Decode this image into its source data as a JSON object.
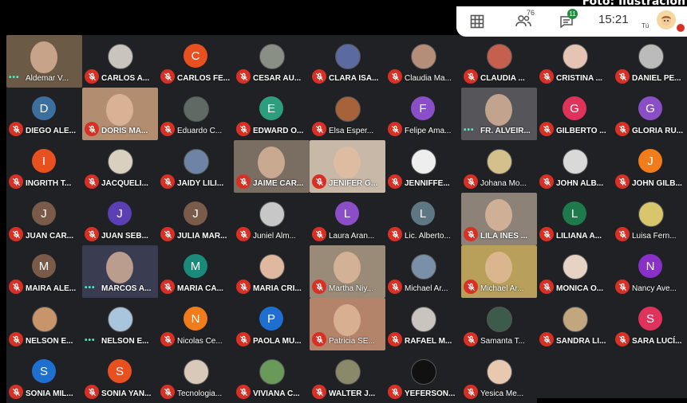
{
  "photo_credit": "Foto: Ilustración",
  "toolbar": {
    "people_count": "76",
    "chat_count": "11",
    "time": "15:21",
    "self_label": "Tú",
    "icons": [
      "grid-icon",
      "people-icon",
      "chat-icon",
      "avatar"
    ]
  },
  "colors": {
    "grid_bg": "#202124",
    "muted_red": "#d93025",
    "speaking_green": "#4ff0c7"
  },
  "participants": [
    {
      "name": "Aldemar V...",
      "kind": "video",
      "mic": "speaking",
      "bg": "#6b5a45"
    },
    {
      "name": "CARLOS A...",
      "kind": "photo",
      "mic": "muted",
      "bg": "#c9c5be"
    },
    {
      "name": "CARLOS FE...",
      "kind": "letter",
      "letter": "C",
      "mic": "muted",
      "bg": "#e8511f"
    },
    {
      "name": "CESAR AU...",
      "kind": "photo",
      "mic": "muted",
      "bg": "#8a8f86"
    },
    {
      "name": "CLARA ISA...",
      "kind": "photo",
      "mic": "muted",
      "bg": "#5b6aa0"
    },
    {
      "name": "Claudia Ma...",
      "kind": "photo",
      "mic": "muted",
      "bg": "#b58e7a"
    },
    {
      "name": "CLAUDIA ...",
      "kind": "photo",
      "mic": "muted",
      "bg": "#c55f4e"
    },
    {
      "name": "CRISTINA ...",
      "kind": "photo",
      "mic": "muted",
      "bg": "#e6c4b3"
    },
    {
      "name": "DANIEL PE...",
      "kind": "photo",
      "mic": "muted",
      "bg": "#bbbbbb"
    },
    {
      "name": "DIEGO ALE...",
      "kind": "letter",
      "letter": "D",
      "mic": "muted",
      "bg": "#3c6e9e"
    },
    {
      "name": "DORIS MA...",
      "kind": "video",
      "mic": "muted",
      "bg": "#b38d70"
    },
    {
      "name": "Eduardo C...",
      "kind": "photo",
      "mic": "muted",
      "bg": "#5e6a63"
    },
    {
      "name": "EDWARD O...",
      "kind": "letter",
      "letter": "E",
      "mic": "muted",
      "bg": "#2e9d7d"
    },
    {
      "name": "Elsa Esper...",
      "kind": "photo",
      "mic": "muted",
      "bg": "#a8623a"
    },
    {
      "name": "Felipe Ama...",
      "kind": "letter",
      "letter": "F",
      "mic": "muted",
      "bg": "#8a4fc7"
    },
    {
      "name": "FR. ALVEIR...",
      "kind": "video",
      "mic": "speaking",
      "bg": "#55555a"
    },
    {
      "name": "GILBERTO ...",
      "kind": "letter",
      "letter": "G",
      "mic": "muted",
      "bg": "#e0335c"
    },
    {
      "name": "GLORIA RU...",
      "kind": "letter",
      "letter": "G",
      "mic": "muted",
      "bg": "#8a4fc7"
    },
    {
      "name": "INGRITH T...",
      "kind": "letter",
      "letter": "I",
      "mic": "muted",
      "bg": "#e8511f"
    },
    {
      "name": "JACQUELI...",
      "kind": "photo",
      "mic": "muted",
      "bg": "#d9d0c0"
    },
    {
      "name": "JAIDY LILI...",
      "kind": "photo",
      "mic": "muted",
      "bg": "#6d84a6"
    },
    {
      "name": "JAIME CAR...",
      "kind": "video",
      "mic": "muted",
      "bg": "#7a6e63"
    },
    {
      "name": "JENIFER G...",
      "kind": "video",
      "mic": "muted",
      "bg": "#c8b8a8"
    },
    {
      "name": "JENNIFFE...",
      "kind": "photo",
      "mic": "muted",
      "bg": "#eeeeee"
    },
    {
      "name": "Johana Mo...",
      "kind": "photo",
      "mic": "muted",
      "bg": "#d4c08a"
    },
    {
      "name": "JOHN ALB...",
      "kind": "photo",
      "mic": "muted",
      "bg": "#d9d9d9"
    },
    {
      "name": "JOHN GILB...",
      "kind": "letter",
      "letter": "J",
      "mic": "muted",
      "bg": "#f07c1b"
    },
    {
      "name": "JUAN CAR...",
      "kind": "letter",
      "letter": "J",
      "mic": "muted",
      "bg": "#7a5a48"
    },
    {
      "name": "JUAN SEB...",
      "kind": "letter",
      "letter": "J",
      "mic": "muted",
      "bg": "#5a3fb5"
    },
    {
      "name": "JULIA MAR...",
      "kind": "letter",
      "letter": "J",
      "mic": "muted",
      "bg": "#7a5a48"
    },
    {
      "name": "Juniel Alm...",
      "kind": "photo",
      "mic": "muted",
      "bg": "#c7c7c7"
    },
    {
      "name": "Laura Aran...",
      "kind": "letter",
      "letter": "L",
      "mic": "muted",
      "bg": "#8a4fc7"
    },
    {
      "name": "Lic. Alberto...",
      "kind": "letter",
      "letter": "L",
      "mic": "muted",
      "bg": "#5f7683"
    },
    {
      "name": "LILA INES ...",
      "kind": "video",
      "mic": "muted",
      "bg": "#8c8278"
    },
    {
      "name": "LILIANA A...",
      "kind": "letter",
      "letter": "L",
      "mic": "muted",
      "bg": "#1e7a4a"
    },
    {
      "name": "Luisa Fern...",
      "kind": "photo",
      "mic": "muted",
      "bg": "#d9c56b"
    },
    {
      "name": "MAIRA ALE...",
      "kind": "letter",
      "letter": "M",
      "mic": "muted",
      "bg": "#7a5a48"
    },
    {
      "name": "MARCOS A...",
      "kind": "video",
      "mic": "speaking",
      "bg": "#3a3d52"
    },
    {
      "name": "MARIA CA...",
      "kind": "letter",
      "letter": "M",
      "mic": "muted",
      "bg": "#1a8a7a"
    },
    {
      "name": "MARIA CRI...",
      "kind": "photo",
      "mic": "muted",
      "bg": "#e0b8a0"
    },
    {
      "name": "Martha Niy...",
      "kind": "video",
      "mic": "muted",
      "bg": "#9a8a78"
    },
    {
      "name": "Michael Ar...",
      "kind": "photo",
      "mic": "muted",
      "bg": "#7a8fa8"
    },
    {
      "name": "Michael Ar...",
      "kind": "video",
      "mic": "muted",
      "bg": "#b8a05a"
    },
    {
      "name": "MONICA O...",
      "kind": "photo",
      "mic": "muted",
      "bg": "#e6d3c3"
    },
    {
      "name": "Nancy Ave...",
      "kind": "letter",
      "letter": "N",
      "mic": "muted",
      "bg": "#8a2fc7"
    },
    {
      "name": "NELSON E...",
      "kind": "photo",
      "mic": "muted",
      "bg": "#c8956a"
    },
    {
      "name": "NELSON E...",
      "kind": "photo",
      "mic": "speaking",
      "bg": "#a9c4dd"
    },
    {
      "name": "Nicolas Ce...",
      "kind": "letter",
      "letter": "N",
      "mic": "muted",
      "bg": "#f07c1b"
    },
    {
      "name": "PAOLA MU...",
      "kind": "letter",
      "letter": "P",
      "mic": "muted",
      "bg": "#1f6fd1"
    },
    {
      "name": "Patricia SE...",
      "kind": "video",
      "mic": "muted",
      "bg": "#b4846a"
    },
    {
      "name": "RAFAEL M...",
      "kind": "photo",
      "mic": "muted",
      "bg": "#c9c5be"
    },
    {
      "name": "Samanta T...",
      "kind": "photo",
      "mic": "muted",
      "bg": "#3d5b4a"
    },
    {
      "name": "SANDRA LI...",
      "kind": "photo",
      "mic": "muted",
      "bg": "#c2a77e"
    },
    {
      "name": "SARA LUCÍ...",
      "kind": "letter",
      "letter": "S",
      "mic": "muted",
      "bg": "#e0335c"
    },
    {
      "name": "SONIA MIL...",
      "kind": "letter",
      "letter": "S",
      "mic": "muted",
      "bg": "#1f6fd1"
    },
    {
      "name": "SONIA YAN...",
      "kind": "letter",
      "letter": "S",
      "mic": "muted",
      "bg": "#e8511f"
    },
    {
      "name": "Tecnologia...",
      "kind": "photo",
      "mic": "muted",
      "bg": "#d9c9b8"
    },
    {
      "name": "VIVIANA C...",
      "kind": "photo",
      "mic": "muted",
      "bg": "#6a9a5a"
    },
    {
      "name": "WALTER J...",
      "kind": "photo",
      "mic": "muted",
      "bg": "#8a8a6a"
    },
    {
      "name": "YEFERSON...",
      "kind": "photo",
      "mic": "muted",
      "bg": "#111111"
    },
    {
      "name": "Yesica Me...",
      "kind": "photo",
      "mic": "muted",
      "bg": "#e8c9b0"
    }
  ]
}
